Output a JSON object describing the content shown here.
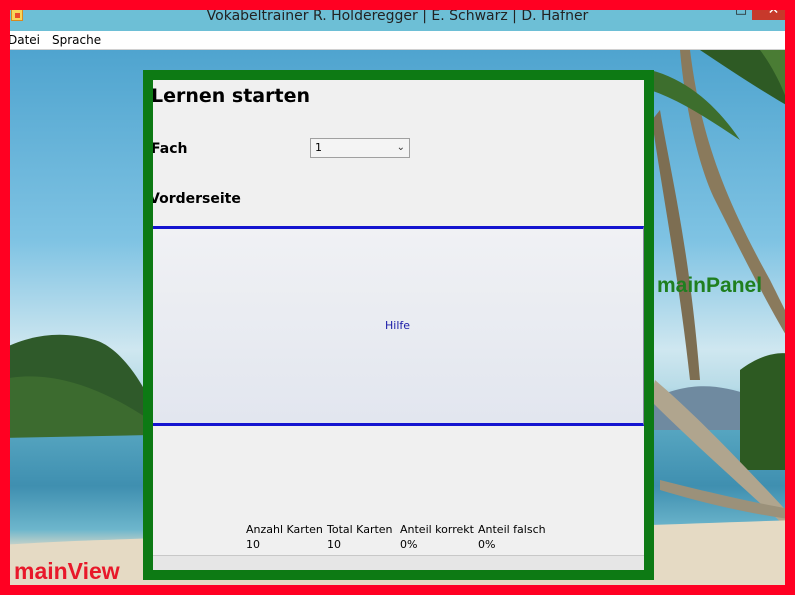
{
  "window": {
    "title": "Vokabeltrainer R. Holderegger | E. Schwarz | D. Hafner",
    "controls": {
      "minimize": "–",
      "maximize": "□",
      "close": "✕"
    }
  },
  "menu": {
    "items": [
      "Datei",
      "Sprache"
    ]
  },
  "labels": {
    "main_view": "mainView",
    "main_panel": "mainPanel"
  },
  "panel": {
    "title": "Lernen starten",
    "fach_label": "Fach",
    "fach_value": "1",
    "vorderseite_label": "Vorderseite",
    "hilfe_link": "Hilfe"
  },
  "stats": [
    {
      "label": "Anzahl Karten",
      "value": "10"
    },
    {
      "label": "Total Karten",
      "value": "10"
    },
    {
      "label": "Anteil korrekt",
      "value": "0%"
    },
    {
      "label": "Anteil falsch",
      "value": "0%"
    }
  ],
  "colors": {
    "main_view_border": "#ff0022",
    "main_panel_border": "#0d7a14",
    "card_border": "#1414d0"
  }
}
